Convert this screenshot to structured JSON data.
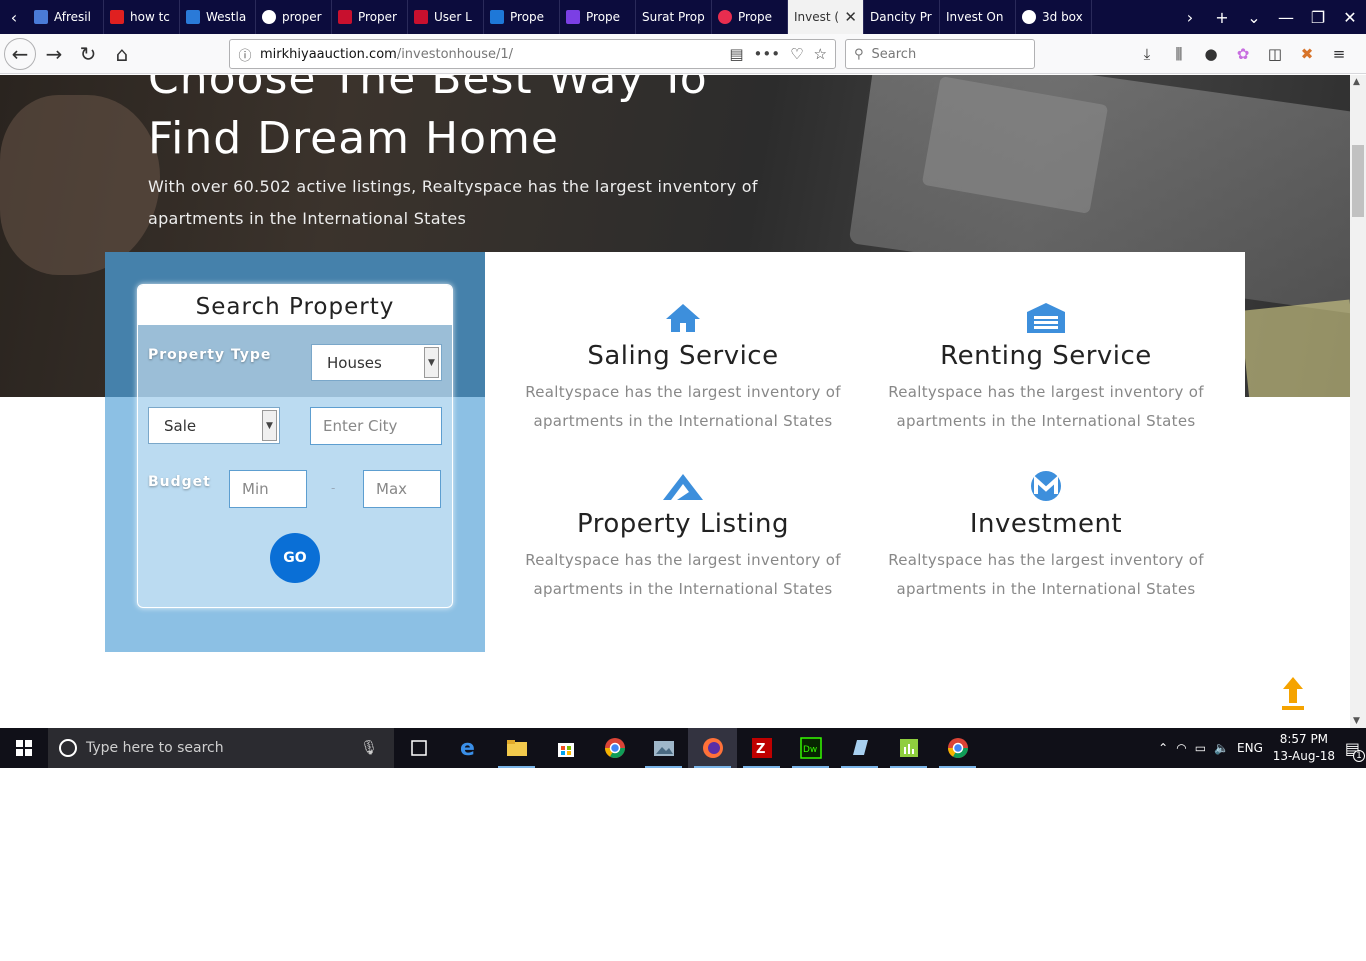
{
  "browser": {
    "tabs": [
      {
        "title": "Afresil",
        "color": "#4a7bd8"
      },
      {
        "title": "how tc",
        "color": "#e02020"
      },
      {
        "title": "Westla",
        "color": "#2a7ad8"
      },
      {
        "title": "proper",
        "color": "#ffffff"
      },
      {
        "title": "Proper",
        "color": "#c8102e"
      },
      {
        "title": "User L",
        "color": "#c8102e"
      },
      {
        "title": "Prope",
        "color": "#1e78d8"
      },
      {
        "title": "Prope",
        "color": "#7b3fe4"
      },
      {
        "title": "Surat Prop",
        "color": ""
      },
      {
        "title": "Prope",
        "color": "#e82d4f"
      },
      {
        "title": "Invest (",
        "color": "",
        "active": true
      },
      {
        "title": "Dancity Pr",
        "color": ""
      },
      {
        "title": "Invest On",
        "color": ""
      },
      {
        "title": "3d box",
        "color": "#ffffff"
      }
    ],
    "url_host": "mirkhiyaauction.com",
    "url_path": "/investonhouse/1/",
    "search_placeholder": "Search"
  },
  "hero": {
    "title_line1": "Choose The Best Way To",
    "title_line2": "Find Dream Home",
    "subtitle": "With over 60.502 active listings, Realtyspace has the largest inventory of apartments in the International States"
  },
  "search": {
    "heading": "Search Property",
    "property_type_label": "Property Type",
    "property_type_value": "Houses",
    "listing_type_value": "Sale",
    "city_placeholder": "Enter City",
    "budget_label": "Budget",
    "min_placeholder": "Min",
    "separator": "-",
    "max_placeholder": "Max",
    "go_label": "GO"
  },
  "services": [
    {
      "icon": "home-icon",
      "title": "Saling Service",
      "desc": "Realtyspace has the largest inventory of apartments in the International States"
    },
    {
      "icon": "garage-icon",
      "title": "Renting Service",
      "desc": "Realtyspace has the largest inventory of apartments in the International States"
    },
    {
      "icon": "paper-plane-icon",
      "title": "Property Listing",
      "desc": "Realtyspace has the largest inventory of apartments in the International States"
    },
    {
      "icon": "monero-icon",
      "title": "Investment",
      "desc": "Realtyspace has the largest inventory of apartments in the International States"
    }
  ],
  "colors": {
    "accent": "#0a6fd6",
    "icon_blue": "#3d8fdc",
    "to_top": "#f5a300",
    "panel_blue": "#8cc0e4"
  },
  "taskbar": {
    "search_placeholder": "Type here to search",
    "language": "ENG",
    "time": "8:57 PM",
    "date": "13-Aug-18",
    "notification_count": "1"
  }
}
